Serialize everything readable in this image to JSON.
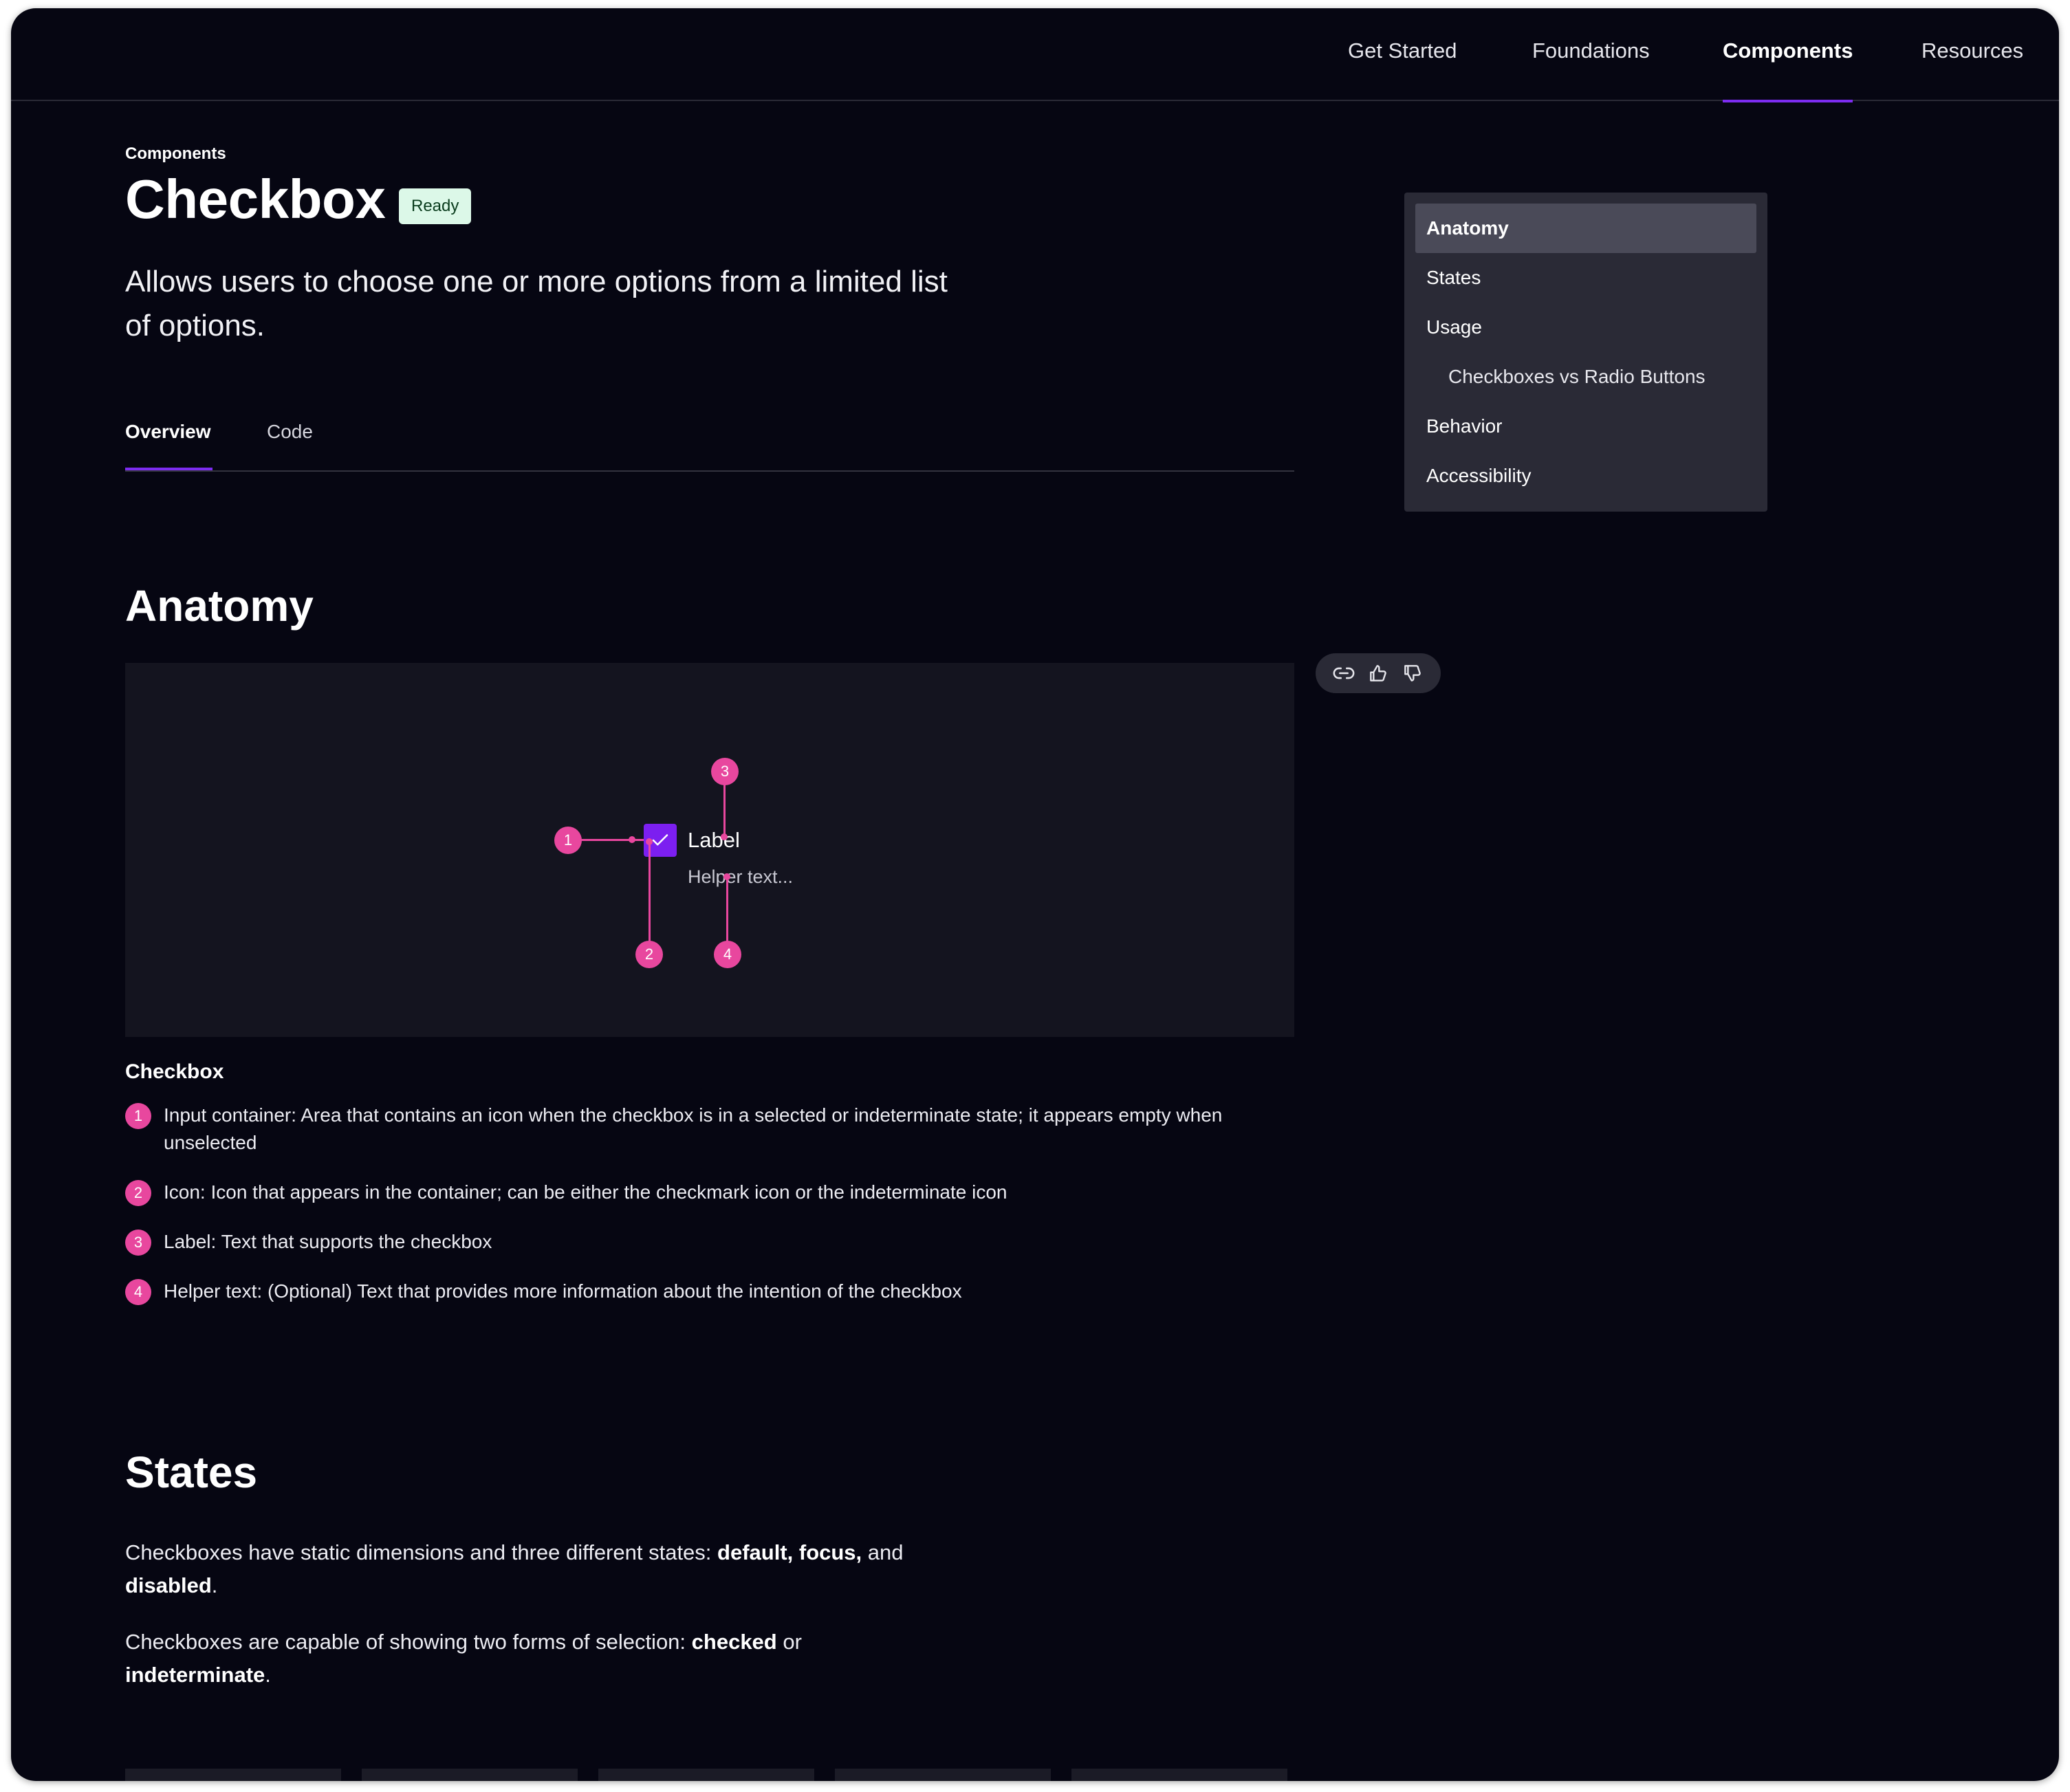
{
  "nav": {
    "items": [
      {
        "label": "Get Started"
      },
      {
        "label": "Foundations"
      },
      {
        "label": "Components",
        "active": true
      },
      {
        "label": "Resources"
      }
    ]
  },
  "page": {
    "breadcrumb": "Components",
    "title": "Checkbox",
    "badge": "Ready",
    "subtitle": "Allows users to choose one or more options from a limited list of options."
  },
  "tabs": [
    {
      "label": "Overview",
      "active": true
    },
    {
      "label": "Code"
    }
  ],
  "toc": {
    "items": [
      {
        "label": "Anatomy",
        "active": true
      },
      {
        "label": "States"
      },
      {
        "label": "Usage"
      },
      {
        "label": "Checkboxes vs Radio Buttons",
        "sub": true
      },
      {
        "label": "Behavior"
      },
      {
        "label": "Accessibility"
      }
    ]
  },
  "anatomy": {
    "heading": "Anatomy",
    "demo": {
      "label": "Label",
      "helper": "Helper text..."
    },
    "callouts": [
      "1",
      "2",
      "3",
      "4"
    ],
    "subhead": "Checkbox",
    "items": [
      {
        "num": "1",
        "text": "Input container: Area that contains an icon when the checkbox is in a selected or indeterminate state; it appears empty when unselected"
      },
      {
        "num": "2",
        "text": "Icon: Icon that appears in the container; can be either the checkmark icon or the indeterminate icon"
      },
      {
        "num": "3",
        "text": "Label: Text that supports the checkbox"
      },
      {
        "num": "4",
        "text": "Helper text: (Optional) Text that provides more information about the intention of the checkbox"
      }
    ]
  },
  "feedback": {
    "icons": [
      "link-icon",
      "thumbs-up-icon",
      "thumbs-down-icon"
    ]
  },
  "states": {
    "heading": "States",
    "p1": {
      "pre": "Checkboxes have static dimensions and three different states: ",
      "b1": "default, focus,",
      "mid": " and ",
      "b2": "disabled",
      "post": "."
    },
    "p2": {
      "pre": "Checkboxes are capable of showing two forms of selection: ",
      "b1": "checked",
      "mid": " or ",
      "b2": "indeterminate",
      "post": "."
    }
  },
  "colors": {
    "accent": "#7c2cf0",
    "callout": "#e8479e",
    "badge_bg": "#dcf8e8",
    "background": "#060612"
  }
}
